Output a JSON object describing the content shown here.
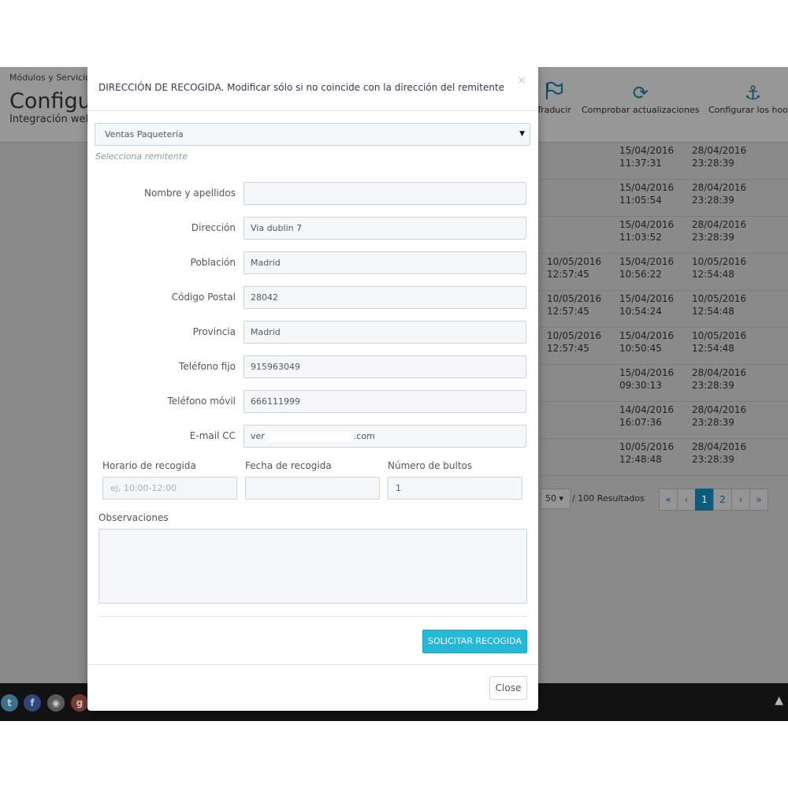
{
  "background": {
    "breadcrumb": "Módulos y Servicios",
    "page_title": "Configurar",
    "subtitle": "Integración web",
    "toolbar": [
      {
        "label": "Traducir",
        "icon": "flag-icon"
      },
      {
        "label": "Comprobar actualizaciones",
        "icon": "refresh-icon"
      },
      {
        "label": "Configurar los hooks",
        "icon": "anchor-icon"
      }
    ],
    "rows": [
      {
        "a": "",
        "a2": "",
        "b": "15/04/2016",
        "b2": "11:37:31",
        "c": "28/04/2016",
        "c2": "23:28:39"
      },
      {
        "a": "",
        "a2": "",
        "b": "15/04/2016",
        "b2": "11:05:54",
        "c": "28/04/2016",
        "c2": "23:28:39"
      },
      {
        "a": "",
        "a2": "",
        "b": "15/04/2016",
        "b2": "11:03:52",
        "c": "28/04/2016",
        "c2": "23:28:39"
      },
      {
        "a": "10/05/2016",
        "a2": "12:57:45",
        "b": "15/04/2016",
        "b2": "10:56:22",
        "c": "10/05/2016",
        "c2": "12:54:48"
      },
      {
        "a": "10/05/2016",
        "a2": "12:57:45",
        "b": "15/04/2016",
        "b2": "10:54:24",
        "c": "10/05/2016",
        "c2": "12:54:48"
      },
      {
        "a": "10/05/2016",
        "a2": "12:57:45",
        "b": "15/04/2016",
        "b2": "10:50:45",
        "c": "10/05/2016",
        "c2": "12:54:48"
      },
      {
        "a": "",
        "a2": "",
        "b": "15/04/2016",
        "b2": "09:30:13",
        "c": "28/04/2016",
        "c2": "23:28:39"
      },
      {
        "a": "",
        "a2": "",
        "b": "14/04/2016",
        "b2": "16:07:36",
        "c": "28/04/2016",
        "c2": "23:28:39"
      },
      {
        "a": "",
        "a2": "",
        "b": "10/05/2016",
        "b2": "12:48:48",
        "c": "28/04/2016",
        "c2": "23:28:39"
      }
    ],
    "pagination": {
      "per_page": "50 ▾",
      "results": "/ 100 Resultados",
      "first": "«",
      "prev": "‹",
      "page1": "1",
      "page2": "2",
      "next": "›",
      "last": "»"
    },
    "social": [
      "twitter-icon",
      "facebook-icon",
      "github-icon",
      "google-plus-icon"
    ],
    "scroll_top": "▲"
  },
  "modal": {
    "title": "DIRECCIÓN DE RECOGIDA. Modificar sólo si no coincide con la dirección del remitente",
    "close_icon": "×",
    "sender_select": {
      "value": "Ventas Paquetería",
      "help": "Selecciona remitente"
    },
    "fields": [
      {
        "label": "Nombre y apellidos",
        "value": ""
      },
      {
        "label": "Dirección",
        "value": "Via dublin 7"
      },
      {
        "label": "Población",
        "value": "Madrid"
      },
      {
        "label": "Código Postal",
        "value": "28042"
      },
      {
        "label": "Provincia",
        "value": "Madrid"
      },
      {
        "label": "Teléfono fijo",
        "value": "915963049"
      },
      {
        "label": "Teléfono móvil",
        "value": "666111999"
      }
    ],
    "email": {
      "label": "E-mail CC",
      "value_start": "ver",
      "value_end": ".com"
    },
    "pickup_time": {
      "label": "Horario de recogida",
      "placeholder": "ej, 10:00-12:00",
      "value": ""
    },
    "pickup_date": {
      "label": "Fecha de recogida",
      "value": ""
    },
    "packages": {
      "label": "Número de bultos",
      "value": "1"
    },
    "notes": {
      "label": "Observaciones",
      "value": ""
    },
    "submit_label": "SOLICITAR RECOGIDA",
    "close_label": "Close"
  }
}
